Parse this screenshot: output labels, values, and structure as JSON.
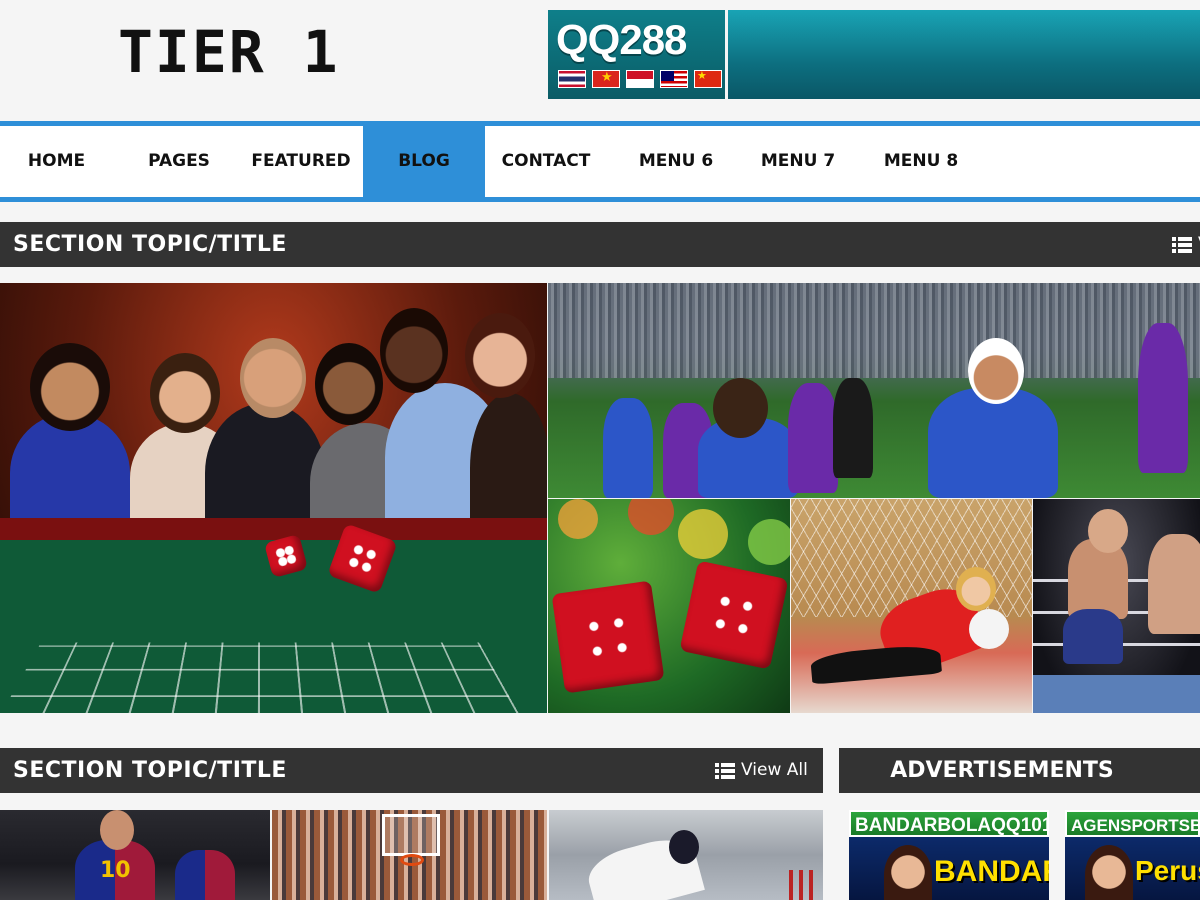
{
  "site": {
    "logo": "TIER 1"
  },
  "banner": {
    "brand": "QQ288"
  },
  "nav": {
    "items": [
      {
        "label": "HOME"
      },
      {
        "label": "PAGES"
      },
      {
        "label": "FEATURED"
      },
      {
        "label": "BLOG",
        "active": true
      },
      {
        "label": "CONTACT"
      },
      {
        "label": "MENU 6"
      },
      {
        "label": "MENU 7"
      },
      {
        "label": "MENU 8"
      }
    ]
  },
  "featured_section": {
    "title": "SECTION TOPIC/TITLE",
    "view_all": "V"
  },
  "second_section": {
    "title": "SECTION TOPIC/TITLE",
    "view_all": "View All"
  },
  "ads": {
    "title": "ADVERTISEMENTS",
    "items": [
      {
        "header": "BANDARBOLAQQ101",
        "word": "BANDAR"
      },
      {
        "header": "AGENSPORTSBOOK",
        "word": "Perusa"
      }
    ]
  },
  "thumbs": {
    "t1_jersey_number": "10"
  },
  "colors": {
    "accent": "#2e8fd8",
    "section_bar": "#333333"
  }
}
